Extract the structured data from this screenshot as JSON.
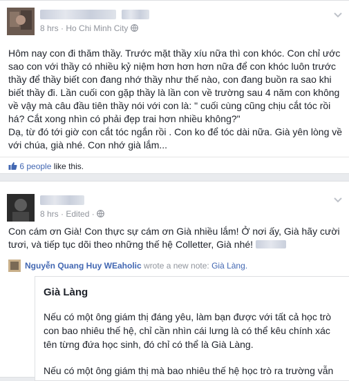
{
  "post1": {
    "meta_time": "8 hrs",
    "meta_location": "Ho Chi Minh City",
    "text_lines": [
      "Hôm nay con đi thăm thầy. Trước mặt thầy xíu nữa thì con khóc. Con chỉ ước",
      "sao con với thầy có nhiều kỷ niệm hơn hơn hơn nữa để con khóc luôn trước",
      "thầy để thầy biết con đang nhớ thầy như thế nào, con đang buồn ra sao khi",
      "biết thầy đi. Lần cuối con gặp thầy là lần con về trường sau 4 năm con không",
      "về vậy mà câu đầu tiên thầy nói với con là: \" cuối cùng cũng chịu cắt tóc rồi",
      "há? Cắt xong nhìn có phải đẹp trai hơn nhiều không?\"",
      "Dạ, từ đó tới giờ con cắt tóc ngắn rồi . Con ko để tóc dài nữa. Già yên lòng về",
      "với chúa, già nhé. Con nhớ già lắm..."
    ],
    "likes_count_text": "6 people",
    "likes_suffix": " like this."
  },
  "post2": {
    "meta_time": "8 hrs",
    "meta_edited": "Edited",
    "text_lines": [
      "Con cám ơn Già! Con thực sự cám ơn Già nhiều lắm! Ở nơi ấy, Già hãy cười",
      "tươi, và tiếp tục dõi theo những thế hệ Colletter, Già nhé!"
    ],
    "shared": {
      "author": "Nguyễn Quang Huy WEaholic",
      "action": " wrote a new note: ",
      "note_name": "Già Làng.",
      "note_title": "Già Làng",
      "note_para1": [
        "Nếu có một ông giám thị đáng yêu, làm bạn được với tất cả học trò",
        "con bao nhiêu thế hệ, chỉ cần nhìn cái lưng là có thể kêu chính xác",
        "tên từng đứa học sinh, đó chỉ có thể là Già Làng."
      ],
      "note_para2": [
        "Nếu có một ông giám thị mà bao nhiêu thế hệ học trò ra trường vẫn"
      ]
    }
  },
  "icons": {
    "chevron": "chevron-down-icon",
    "globe": "globe-icon",
    "like": "like-thumb-icon"
  },
  "colors": {
    "link": "#4267b2",
    "meta": "#90949c",
    "text": "#1d2129"
  }
}
